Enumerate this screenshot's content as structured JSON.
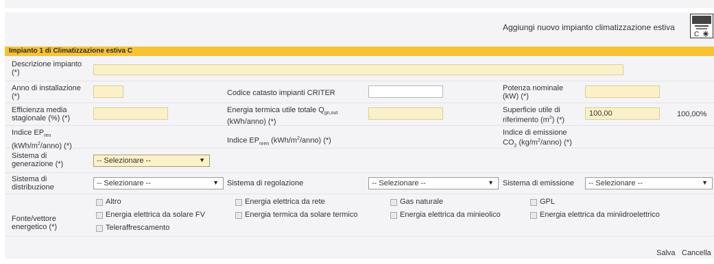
{
  "header": {
    "add_link": "Aggiungi nuovo impianto climatizzazione estiva",
    "add_icon_text": "C"
  },
  "section": {
    "title": "Impianto 1 di Climatizzazione estiva C"
  },
  "fields": {
    "descrizione": {
      "label": "Descrizione impianto (*)",
      "value": ""
    },
    "anno": {
      "label": "Anno di installazione (*)",
      "value": ""
    },
    "codice": {
      "label": "Codice catasto impianti CRITER",
      "value": ""
    },
    "potenza": {
      "label": "Potenza nominale (kW) (*)",
      "value": ""
    },
    "efficienza": {
      "label": "Efficienza media stagionale (%) (*)",
      "value": ""
    },
    "energia_termica": {
      "label_main": "Energia termica utile totale Q",
      "label_sub": "gn,out",
      "label_unit": "(kWh/anno) (*)",
      "value": ""
    },
    "superficie": {
      "label_a": "Superficie utile di",
      "label_b": "riferimento (m",
      "label_sup": "2",
      "label_c": ") (*)",
      "value": "100,00",
      "percent": "100,00%"
    },
    "ep_ren": {
      "label_a": "Indice EP",
      "label_sub": "ren",
      "label_b": "(kWh/m",
      "label_sup": "2",
      "label_c": "/anno) (*)"
    },
    "ep_nren": {
      "label_a": "Indice EP",
      "label_sub": "nren",
      "label_b": " (kWh/m",
      "label_sup": "2",
      "label_c": "/anno) (*)"
    },
    "co2": {
      "label_a": "Indice di emissione",
      "label_b": "CO",
      "label_sub": "2",
      "label_c": " (kg/m",
      "label_sup": "2",
      "label_d": "/anno) (*)"
    }
  },
  "selects": {
    "generazione": {
      "label": "Sistema di generazione (*)",
      "value": "-- Selezionare --"
    },
    "distribuzione": {
      "label": "Sistema di distribuzione",
      "value": "-- Selezionare --"
    },
    "regolazione": {
      "label": "Sistema di regolazione",
      "value": "-- Selezionare --"
    },
    "emissione": {
      "label": "Sistema di emissione",
      "value": "-- Selezionare --"
    }
  },
  "fonte": {
    "label": "Fonte/vettore energetico (*)",
    "options": [
      "Altro",
      "Energia elettrica da rete",
      "Gas naturale",
      "GPL",
      "Energia elettrica da solare FV",
      "Energia termica da solare termico",
      "Energia elettrica da minieolico",
      "Energia elettrica da miniidroelettrico",
      "Teleraffrescamento"
    ]
  },
  "actions": {
    "save": "Salva",
    "cancel": "Cancella"
  }
}
